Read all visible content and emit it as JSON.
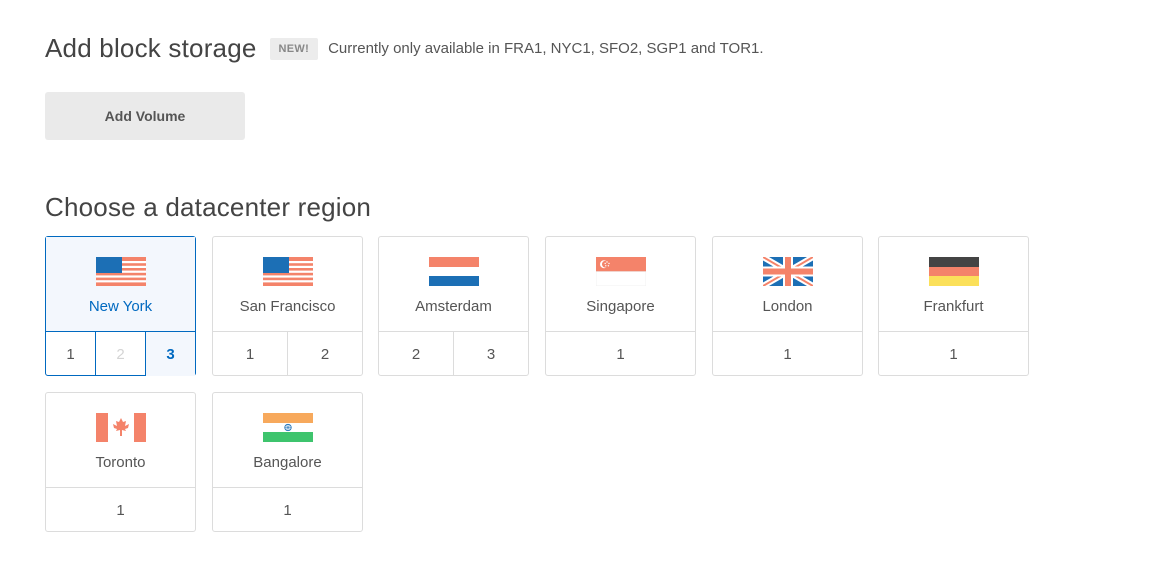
{
  "storage": {
    "title": "Add block storage",
    "badge": "NEW!",
    "availability": "Currently only available in FRA1, NYC1, SFO2, SGP1 and TOR1.",
    "add_volume_label": "Add Volume"
  },
  "region": {
    "title": "Choose a datacenter region",
    "selected_color": "#0069c0",
    "cards": [
      {
        "city": "New York",
        "flag": "us-flag-icon",
        "numbers": [
          "1",
          "2",
          "3"
        ],
        "disabled": [
          "2"
        ],
        "active": "3"
      },
      {
        "city": "San Francisco",
        "flag": "us-flag-icon",
        "numbers": [
          "1",
          "2"
        ]
      },
      {
        "city": "Amsterdam",
        "flag": "netherlands-flag-icon",
        "numbers": [
          "2",
          "3"
        ]
      },
      {
        "city": "Singapore",
        "flag": "singapore-flag-icon",
        "numbers": [
          "1"
        ]
      },
      {
        "city": "London",
        "flag": "uk-flag-icon",
        "numbers": [
          "1"
        ]
      },
      {
        "city": "Frankfurt",
        "flag": "germany-flag-icon",
        "numbers": [
          "1"
        ]
      },
      {
        "city": "Toronto",
        "flag": "canada-flag-icon",
        "numbers": [
          "1"
        ]
      },
      {
        "city": "Bangalore",
        "flag": "india-flag-icon",
        "numbers": [
          "1"
        ]
      }
    ]
  }
}
